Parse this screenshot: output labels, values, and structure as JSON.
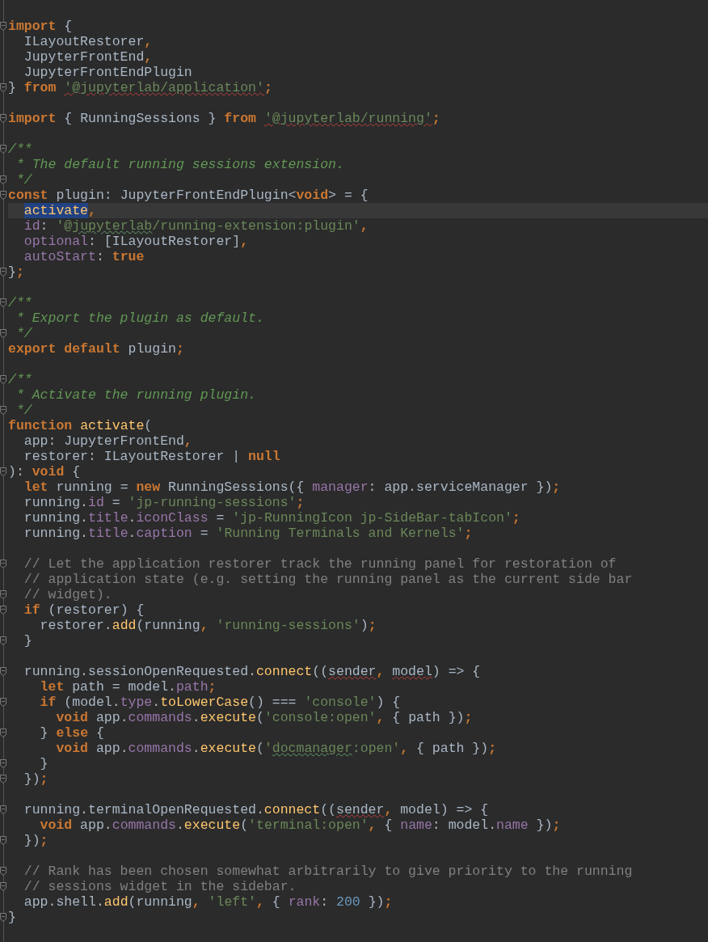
{
  "editor": {
    "lines": [
      {
        "kind": "code",
        "fold": true,
        "spans": [
          {
            "kind": "k",
            "text": "import"
          },
          {
            "kind": "p",
            "text": " {"
          }
        ]
      },
      {
        "kind": "code",
        "spans": [
          {
            "kind": "p",
            "text": "  ILayoutRestorer"
          },
          {
            "kind": "k",
            "text": ","
          }
        ]
      },
      {
        "kind": "code",
        "spans": [
          {
            "kind": "p",
            "text": "  JupyterFrontEnd"
          },
          {
            "kind": "k",
            "text": ","
          }
        ]
      },
      {
        "kind": "code",
        "spans": [
          {
            "kind": "p",
            "text": "  JupyterFrontEndPlugin"
          }
        ]
      },
      {
        "kind": "code",
        "fold": true,
        "spans": [
          {
            "kind": "p",
            "text": "} "
          },
          {
            "kind": "k",
            "text": "from "
          },
          {
            "kind": "s",
            "text": "'@jupyterlab/application'",
            "misspelled": true
          },
          {
            "kind": "k",
            "text": ";"
          }
        ]
      },
      {
        "kind": "blank"
      },
      {
        "kind": "code",
        "fold": true,
        "spans": [
          {
            "kind": "k",
            "text": "import"
          },
          {
            "kind": "p",
            "text": " { RunningSessions } "
          },
          {
            "kind": "k",
            "text": "from "
          },
          {
            "kind": "s",
            "text": "'@jupyterlab/running'",
            "misspelled": true
          },
          {
            "kind": "k",
            "text": ";"
          }
        ]
      },
      {
        "kind": "blank"
      },
      {
        "kind": "code",
        "fold": true,
        "spans": [
          {
            "kind": "d",
            "text": "/**"
          }
        ]
      },
      {
        "kind": "code",
        "spans": [
          {
            "kind": "d",
            "text": " * The default running sessions extension."
          }
        ]
      },
      {
        "kind": "code",
        "fold": true,
        "spans": [
          {
            "kind": "d",
            "text": " */"
          }
        ]
      },
      {
        "kind": "code",
        "fold": true,
        "spans": [
          {
            "kind": "k",
            "text": "const"
          },
          {
            "kind": "p",
            "text": " plugin: JupyterFrontEndPlugin<"
          },
          {
            "kind": "k",
            "text": "void"
          },
          {
            "kind": "p",
            "text": "> = {"
          }
        ]
      },
      {
        "kind": "code",
        "current": true,
        "spans": [
          {
            "kind": "f",
            "text": "  activate",
            "highlight": true
          },
          {
            "kind": "k",
            "text": ","
          }
        ]
      },
      {
        "kind": "code",
        "spans": [
          {
            "kind": "m",
            "text": "  id"
          },
          {
            "kind": "p",
            "text": ": "
          },
          {
            "kind": "s",
            "text": "'@"
          },
          {
            "kind": "s",
            "text": "jupyterlab",
            "typo": true
          },
          {
            "kind": "s",
            "text": "/running-extension:plugin'"
          },
          {
            "kind": "k",
            "text": ","
          }
        ]
      },
      {
        "kind": "code",
        "spans": [
          {
            "kind": "m",
            "text": "  optional"
          },
          {
            "kind": "p",
            "text": ": [ILayoutRestorer]"
          },
          {
            "kind": "k",
            "text": ","
          }
        ]
      },
      {
        "kind": "code",
        "spans": [
          {
            "kind": "m",
            "text": "  autoStart"
          },
          {
            "kind": "p",
            "text": ": "
          },
          {
            "kind": "k",
            "text": "true"
          }
        ]
      },
      {
        "kind": "code",
        "fold": true,
        "spans": [
          {
            "kind": "p",
            "text": "}"
          },
          {
            "kind": "k",
            "text": ";"
          }
        ]
      },
      {
        "kind": "blank"
      },
      {
        "kind": "code",
        "fold": true,
        "spans": [
          {
            "kind": "d",
            "text": "/**"
          }
        ]
      },
      {
        "kind": "code",
        "spans": [
          {
            "kind": "d",
            "text": " * Export the plugin as default."
          }
        ]
      },
      {
        "kind": "code",
        "fold": true,
        "spans": [
          {
            "kind": "d",
            "text": " */"
          }
        ]
      },
      {
        "kind": "code",
        "spans": [
          {
            "kind": "k",
            "text": "export default"
          },
          {
            "kind": "p",
            "text": " plugin"
          },
          {
            "kind": "k",
            "text": ";"
          }
        ]
      },
      {
        "kind": "blank"
      },
      {
        "kind": "code",
        "fold": true,
        "spans": [
          {
            "kind": "d",
            "text": "/**"
          }
        ]
      },
      {
        "kind": "code",
        "spans": [
          {
            "kind": "d",
            "text": " * Activate the running plugin."
          }
        ]
      },
      {
        "kind": "code",
        "fold": true,
        "spans": [
          {
            "kind": "d",
            "text": " */"
          }
        ]
      },
      {
        "kind": "code",
        "spans": [
          {
            "kind": "k",
            "text": "function "
          },
          {
            "kind": "f",
            "text": "activate"
          },
          {
            "kind": "p",
            "text": "("
          }
        ]
      },
      {
        "kind": "code",
        "spans": [
          {
            "kind": "p",
            "text": "  app: JupyterFrontEnd"
          },
          {
            "kind": "k",
            "text": ","
          }
        ]
      },
      {
        "kind": "code",
        "spans": [
          {
            "kind": "p",
            "text": "  restorer: ILayoutRestorer | "
          },
          {
            "kind": "k",
            "text": "null"
          }
        ]
      },
      {
        "kind": "code",
        "fold": true,
        "spans": [
          {
            "kind": "p",
            "text": "): "
          },
          {
            "kind": "k",
            "text": "void"
          },
          {
            "kind": "p",
            "text": " {"
          }
        ]
      },
      {
        "kind": "code",
        "spans": [
          {
            "kind": "k",
            "text": "  let"
          },
          {
            "kind": "p",
            "text": " running = "
          },
          {
            "kind": "k",
            "text": "new"
          },
          {
            "kind": "p",
            "text": " RunningSessions({ "
          },
          {
            "kind": "m",
            "text": "manager"
          },
          {
            "kind": "p",
            "text": ": app.serviceManager })"
          },
          {
            "kind": "k",
            "text": ";"
          }
        ]
      },
      {
        "kind": "code",
        "spans": [
          {
            "kind": "p",
            "text": "  running."
          },
          {
            "kind": "m",
            "text": "id"
          },
          {
            "kind": "p",
            "text": " = "
          },
          {
            "kind": "s",
            "text": "'jp-running-sessions'"
          },
          {
            "kind": "k",
            "text": ";"
          }
        ]
      },
      {
        "kind": "code",
        "spans": [
          {
            "kind": "p",
            "text": "  running."
          },
          {
            "kind": "m",
            "text": "title"
          },
          {
            "kind": "p",
            "text": "."
          },
          {
            "kind": "m",
            "text": "iconClass"
          },
          {
            "kind": "p",
            "text": " = "
          },
          {
            "kind": "s",
            "text": "'jp-RunningIcon jp-SideBar-tabIcon'"
          },
          {
            "kind": "k",
            "text": ";"
          }
        ]
      },
      {
        "kind": "code",
        "spans": [
          {
            "kind": "p",
            "text": "  running."
          },
          {
            "kind": "m",
            "text": "title"
          },
          {
            "kind": "p",
            "text": "."
          },
          {
            "kind": "m",
            "text": "caption"
          },
          {
            "kind": "p",
            "text": " = "
          },
          {
            "kind": "s",
            "text": "'Running Terminals and Kernels'"
          },
          {
            "kind": "k",
            "text": ";"
          }
        ]
      },
      {
        "kind": "blank"
      },
      {
        "kind": "code",
        "fold": true,
        "spans": [
          {
            "kind": "c",
            "text": "  // Let the application restorer track the running panel for restoration of"
          }
        ]
      },
      {
        "kind": "code",
        "spans": [
          {
            "kind": "c",
            "text": "  // application state (e.g. setting the running panel as the current side bar"
          }
        ]
      },
      {
        "kind": "code",
        "fold": true,
        "spans": [
          {
            "kind": "c",
            "text": "  // widget)."
          }
        ]
      },
      {
        "kind": "code",
        "fold": true,
        "spans": [
          {
            "kind": "k",
            "text": "  if"
          },
          {
            "kind": "p",
            "text": " (restorer) {"
          }
        ]
      },
      {
        "kind": "code",
        "spans": [
          {
            "kind": "p",
            "text": "    restorer."
          },
          {
            "kind": "f",
            "text": "add"
          },
          {
            "kind": "p",
            "text": "(running"
          },
          {
            "kind": "k",
            "text": ", "
          },
          {
            "kind": "s",
            "text": "'running-sessions'"
          },
          {
            "kind": "p",
            "text": ")"
          },
          {
            "kind": "k",
            "text": ";"
          }
        ]
      },
      {
        "kind": "code",
        "fold": true,
        "spans": [
          {
            "kind": "p",
            "text": "  }"
          }
        ]
      },
      {
        "kind": "blank"
      },
      {
        "kind": "code",
        "fold": true,
        "spans": [
          {
            "kind": "p",
            "text": "  running.sessionOpenRequested."
          },
          {
            "kind": "f",
            "text": "connect"
          },
          {
            "kind": "p",
            "text": "(("
          },
          {
            "kind": "p",
            "text": "sender",
            "misspelled": true
          },
          {
            "kind": "k",
            "text": ", "
          },
          {
            "kind": "p",
            "text": "model",
            "misspelled": true
          },
          {
            "kind": "p",
            "text": ") => {"
          }
        ]
      },
      {
        "kind": "code",
        "spans": [
          {
            "kind": "k",
            "text": "    let"
          },
          {
            "kind": "p",
            "text": " path = model."
          },
          {
            "kind": "m",
            "text": "path"
          },
          {
            "kind": "k",
            "text": ";"
          }
        ]
      },
      {
        "kind": "code",
        "fold": true,
        "spans": [
          {
            "kind": "k",
            "text": "    if"
          },
          {
            "kind": "p",
            "text": " (model."
          },
          {
            "kind": "m",
            "text": "type"
          },
          {
            "kind": "p",
            "text": "."
          },
          {
            "kind": "f",
            "text": "toLowerCase"
          },
          {
            "kind": "p",
            "text": "() === "
          },
          {
            "kind": "s",
            "text": "'console'"
          },
          {
            "kind": "p",
            "text": ") {"
          }
        ]
      },
      {
        "kind": "code",
        "spans": [
          {
            "kind": "k",
            "text": "      void"
          },
          {
            "kind": "p",
            "text": " app."
          },
          {
            "kind": "m",
            "text": "commands"
          },
          {
            "kind": "p",
            "text": "."
          },
          {
            "kind": "f",
            "text": "execute"
          },
          {
            "kind": "p",
            "text": "("
          },
          {
            "kind": "s",
            "text": "'console:open'"
          },
          {
            "kind": "k",
            "text": ", "
          },
          {
            "kind": "p",
            "text": "{ path })"
          },
          {
            "kind": "k",
            "text": ";"
          }
        ]
      },
      {
        "kind": "code",
        "fold": true,
        "spans": [
          {
            "kind": "p",
            "text": "    } "
          },
          {
            "kind": "k",
            "text": "else"
          },
          {
            "kind": "p",
            "text": " {"
          }
        ]
      },
      {
        "kind": "code",
        "spans": [
          {
            "kind": "k",
            "text": "      void"
          },
          {
            "kind": "p",
            "text": " app."
          },
          {
            "kind": "m",
            "text": "commands"
          },
          {
            "kind": "p",
            "text": "."
          },
          {
            "kind": "f",
            "text": "execute"
          },
          {
            "kind": "p",
            "text": "("
          },
          {
            "kind": "s",
            "text": "'"
          },
          {
            "kind": "s",
            "text": "docmanager",
            "typo": true
          },
          {
            "kind": "s",
            "text": ":open'"
          },
          {
            "kind": "k",
            "text": ", "
          },
          {
            "kind": "p",
            "text": "{ path })"
          },
          {
            "kind": "k",
            "text": ";"
          }
        ]
      },
      {
        "kind": "code",
        "fold": true,
        "spans": [
          {
            "kind": "p",
            "text": "    }"
          }
        ]
      },
      {
        "kind": "code",
        "fold": true,
        "spans": [
          {
            "kind": "p",
            "text": "  })"
          },
          {
            "kind": "k",
            "text": ";"
          }
        ]
      },
      {
        "kind": "blank"
      },
      {
        "kind": "code",
        "fold": true,
        "spans": [
          {
            "kind": "p",
            "text": "  running.terminalOpenRequested."
          },
          {
            "kind": "f",
            "text": "connect"
          },
          {
            "kind": "p",
            "text": "(("
          },
          {
            "kind": "p",
            "text": "sender",
            "misspelled": true
          },
          {
            "kind": "k",
            "text": ", "
          },
          {
            "kind": "p",
            "text": "model"
          },
          {
            "kind": "p",
            "text": ") => {"
          }
        ]
      },
      {
        "kind": "code",
        "spans": [
          {
            "kind": "k",
            "text": "    void"
          },
          {
            "kind": "p",
            "text": " app."
          },
          {
            "kind": "m",
            "text": "commands"
          },
          {
            "kind": "p",
            "text": "."
          },
          {
            "kind": "f",
            "text": "execute"
          },
          {
            "kind": "p",
            "text": "("
          },
          {
            "kind": "s",
            "text": "'terminal:open'"
          },
          {
            "kind": "k",
            "text": ", "
          },
          {
            "kind": "p",
            "text": "{ "
          },
          {
            "kind": "m",
            "text": "name"
          },
          {
            "kind": "p",
            "text": ": model."
          },
          {
            "kind": "m",
            "text": "name"
          },
          {
            "kind": "p",
            "text": " })"
          },
          {
            "kind": "k",
            "text": ";"
          }
        ]
      },
      {
        "kind": "code",
        "fold": true,
        "spans": [
          {
            "kind": "p",
            "text": "  })"
          },
          {
            "kind": "k",
            "text": ";"
          }
        ]
      },
      {
        "kind": "blank"
      },
      {
        "kind": "code",
        "fold": true,
        "spans": [
          {
            "kind": "c",
            "text": "  // Rank has been chosen somewhat arbitrarily to give priority to the running"
          }
        ]
      },
      {
        "kind": "code",
        "fold": true,
        "spans": [
          {
            "kind": "c",
            "text": "  // sessions widget in the sidebar."
          }
        ]
      },
      {
        "kind": "code",
        "spans": [
          {
            "kind": "p",
            "text": "  app.shell."
          },
          {
            "kind": "f",
            "text": "add"
          },
          {
            "kind": "p",
            "text": "(running"
          },
          {
            "kind": "k",
            "text": ", "
          },
          {
            "kind": "s",
            "text": "'left'"
          },
          {
            "kind": "k",
            "text": ", "
          },
          {
            "kind": "p",
            "text": "{ "
          },
          {
            "kind": "m",
            "text": "rank"
          },
          {
            "kind": "p",
            "text": ": "
          },
          {
            "kind": "n",
            "text": "200"
          },
          {
            "kind": "p",
            "text": " })"
          },
          {
            "kind": "k",
            "text": ";"
          }
        ]
      },
      {
        "kind": "code",
        "fold": true,
        "spans": [
          {
            "kind": "p",
            "text": "}"
          }
        ]
      }
    ]
  }
}
